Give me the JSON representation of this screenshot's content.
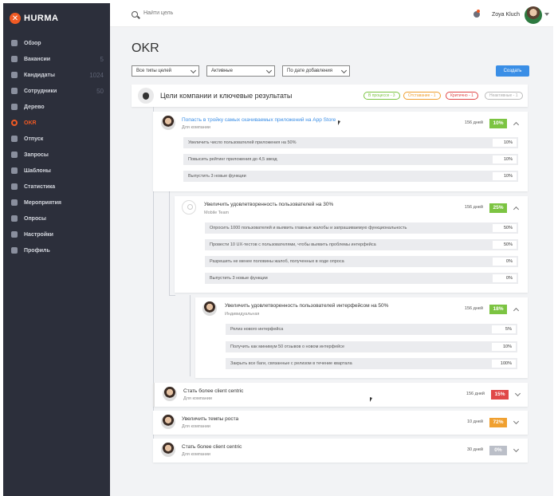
{
  "app": {
    "logo_text": "HURMA"
  },
  "sidebar": {
    "items": [
      {
        "label": "Обзор",
        "icon": "dashboard-icon",
        "count": ""
      },
      {
        "label": "Вакансии",
        "icon": "star-icon",
        "count": "5"
      },
      {
        "label": "Кандидаты",
        "icon": "candidates-icon",
        "count": "1024"
      },
      {
        "label": "Сотрудники",
        "icon": "employees-icon",
        "count": "50"
      },
      {
        "label": "Дерево",
        "icon": "tree-icon",
        "count": ""
      },
      {
        "label": "OKR",
        "icon": "target-icon",
        "count": "",
        "active": true
      },
      {
        "label": "Отпуск",
        "icon": "vacation-icon",
        "count": ""
      },
      {
        "label": "Запросы",
        "icon": "requests-icon",
        "count": ""
      },
      {
        "label": "Шаблоны",
        "icon": "templates-icon",
        "count": ""
      },
      {
        "label": "Статистика",
        "icon": "stats-icon",
        "count": ""
      },
      {
        "label": "Мероприятия",
        "icon": "events-icon",
        "count": ""
      },
      {
        "label": "Опросы",
        "icon": "polls-icon",
        "count": ""
      },
      {
        "label": "Настройки",
        "icon": "settings-icon",
        "count": ""
      },
      {
        "label": "Профиль",
        "icon": "profile-icon",
        "count": ""
      }
    ]
  },
  "topbar": {
    "search_placeholder": "Найти цель",
    "username": "Zoya Kluch"
  },
  "page": {
    "title": "OKR"
  },
  "filters": {
    "type": "Все типы целей",
    "status": "Активные",
    "sort": "По дате добавления",
    "create_label": "Создать"
  },
  "company": {
    "title": "Цели компании и ключевые результаты",
    "pills": [
      {
        "label": "В процессе - 3",
        "color": "#7cc442"
      },
      {
        "label": "Отставание - 1",
        "color": "#f0a030"
      },
      {
        "label": "Критично - 1",
        "color": "#e04848"
      },
      {
        "label": "Неактивные - 1",
        "color": "#bbbbbb"
      }
    ]
  },
  "goals": [
    {
      "title": "Попасть в тройку самых скачиваемых приложений на App Store",
      "subtitle": "Для компании",
      "days": "156 дней",
      "percent": "10%",
      "color": "#7cc442",
      "key_results": [
        {
          "label": "Увеличить число пользователей приложения на 50%",
          "percent": "10%"
        },
        {
          "label": "Повысить рейтинг приложения до 4,5 звезд",
          "percent": "10%"
        },
        {
          "label": "Выпустить 3 новые функции",
          "percent": "10%"
        }
      ]
    },
    {
      "title": "Увеличить удовлетворенность пользователей на 30%",
      "subtitle": "Mobile Team",
      "days": "156 дней",
      "percent": "25%",
      "color": "#7cc442",
      "key_results": [
        {
          "label": "Опросить 1000 пользователей и выявить главные жалобы и запрашиваемую функциональность",
          "percent": "50%"
        },
        {
          "label": "Провести 10 UX-тестов с пользователями, чтобы выявить проблемы интерфейса",
          "percent": "50%"
        },
        {
          "label": "Разрешить не менее половины жалоб, полученных в ходе опроса",
          "percent": "0%"
        },
        {
          "label": "Выпустить 3 новые функции",
          "percent": "0%"
        }
      ]
    },
    {
      "title": "Увеличить удовлетворенность пользователей интерфейсом на 50%",
      "subtitle": "Индивидуальная",
      "days": "156 дней",
      "percent": "18%",
      "color": "#7cc442",
      "key_results": [
        {
          "label": "Релиз нового интерфейса",
          "percent": "5%"
        },
        {
          "label": "Получить как минимум 50 отзывов о новом интерфейсе",
          "percent": "10%"
        },
        {
          "label": "Закрыть все баги, связанные с релизом в течение квартала",
          "percent": "100%"
        }
      ]
    },
    {
      "title": "Стать более client centric",
      "subtitle": "Для компании",
      "days": "156 дней",
      "percent": "15%",
      "color": "#e04848"
    },
    {
      "title": "Увеличить темпы роста",
      "subtitle": "Для компании",
      "days": "10 дней",
      "percent": "72%",
      "color": "#f0a030"
    },
    {
      "title": "Стать более client centric",
      "subtitle": "Для компании",
      "days": "30 дней",
      "percent": "0%",
      "color": "#bbbfc8"
    }
  ]
}
